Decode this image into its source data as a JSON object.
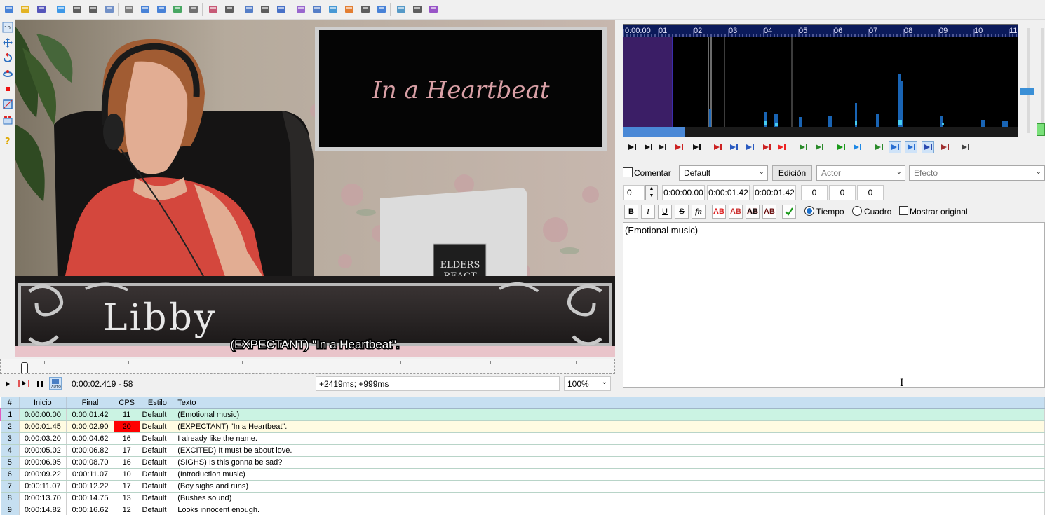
{
  "toolbar": {
    "icons": [
      "new-file-icon",
      "open-file-icon",
      "save-icon",
      "export-icon",
      "find-icon",
      "replace-icon",
      "copy-icon",
      "paste-icon",
      "styles-icon",
      "attachments-icon",
      "fonts-icon",
      "properties-icon",
      "spell-icon",
      "translation-icon",
      "timing-icon",
      "kanji-icon",
      "automation-icon",
      "avatar-icon",
      "video-icon",
      "audio-icon",
      "shift-icon",
      "stop-icon",
      "timer-icon",
      "check-icon",
      "tools-icon",
      "macro-icon"
    ]
  },
  "video": {
    "overlay_title": "In a Heartbeat",
    "name_plate": "Libby",
    "box_label_1": "ELDERS",
    "box_label_2": "REACT",
    "subtitle": "(EXPECTANT) \"In a Heartbeat\"."
  },
  "video_controls": {
    "time": "0:00:02.419 - 58",
    "offset": "+2419ms; +999ms",
    "zoom": "100%"
  },
  "audio": {
    "ticks": [
      "0:00:00",
      "01",
      "02",
      "03",
      "04",
      "05",
      "06",
      "07",
      "08",
      "09",
      "10",
      "11"
    ]
  },
  "edit": {
    "comment_label": "Comentar",
    "style_value": "Default",
    "edit_button": "Edición",
    "actor_placeholder": "Actor",
    "effect_placeholder": "Efecto",
    "layer": "0",
    "start": "0:00:00.00",
    "end": "0:00:01.42",
    "duration": "0:00:01.42",
    "margin_l": "0",
    "margin_r": "0",
    "margin_v": "0",
    "bold": "B",
    "italic": "I",
    "underline": "U",
    "strike": "S",
    "fn": "fn",
    "ab": "AB",
    "time_label": "Tiempo",
    "frame_label": "Cuadro",
    "show_original_label": "Mostrar original",
    "text": "(Emotional music)"
  },
  "grid": {
    "headers": [
      "#",
      "Inicio",
      "Final",
      "CPS",
      "Estilo",
      "Texto"
    ],
    "rows": [
      {
        "n": "1",
        "start": "0:00:00.00",
        "end": "0:00:01.42",
        "cps": "11",
        "style": "Default",
        "text": "(Emotional music)"
      },
      {
        "n": "2",
        "start": "0:00:01.45",
        "end": "0:00:02.90",
        "cps": "20",
        "style": "Default",
        "text": "(EXPECTANT) \"In a Heartbeat\"."
      },
      {
        "n": "3",
        "start": "0:00:03.20",
        "end": "0:00:04.62",
        "cps": "16",
        "style": "Default",
        "text": "I already like the name."
      },
      {
        "n": "4",
        "start": "0:00:05.02",
        "end": "0:00:06.82",
        "cps": "17",
        "style": "Default",
        "text": "(EXCITED) It must be about love."
      },
      {
        "n": "5",
        "start": "0:00:06.95",
        "end": "0:00:08.70",
        "cps": "16",
        "style": "Default",
        "text": "(SIGHS) Is this gonna be sad?"
      },
      {
        "n": "6",
        "start": "0:00:09.22",
        "end": "0:00:11.07",
        "cps": "10",
        "style": "Default",
        "text": "(Introduction music)"
      },
      {
        "n": "7",
        "start": "0:00:11.07",
        "end": "0:00:12.22",
        "cps": "17",
        "style": "Default",
        "text": "(Boy sighs and runs)"
      },
      {
        "n": "8",
        "start": "0:00:13.70",
        "end": "0:00:14.75",
        "cps": "13",
        "style": "Default",
        "text": "(Bushes sound)"
      },
      {
        "n": "9",
        "start": "0:00:14.82",
        "end": "0:00:16.62",
        "cps": "12",
        "style": "Default",
        "text": "Looks innocent enough."
      }
    ],
    "colors": {
      "active_row": "#cbf3e3",
      "selected_row": "#fffbe2",
      "cps_warn": "#ff0000",
      "header": "#c6dff1"
    }
  }
}
